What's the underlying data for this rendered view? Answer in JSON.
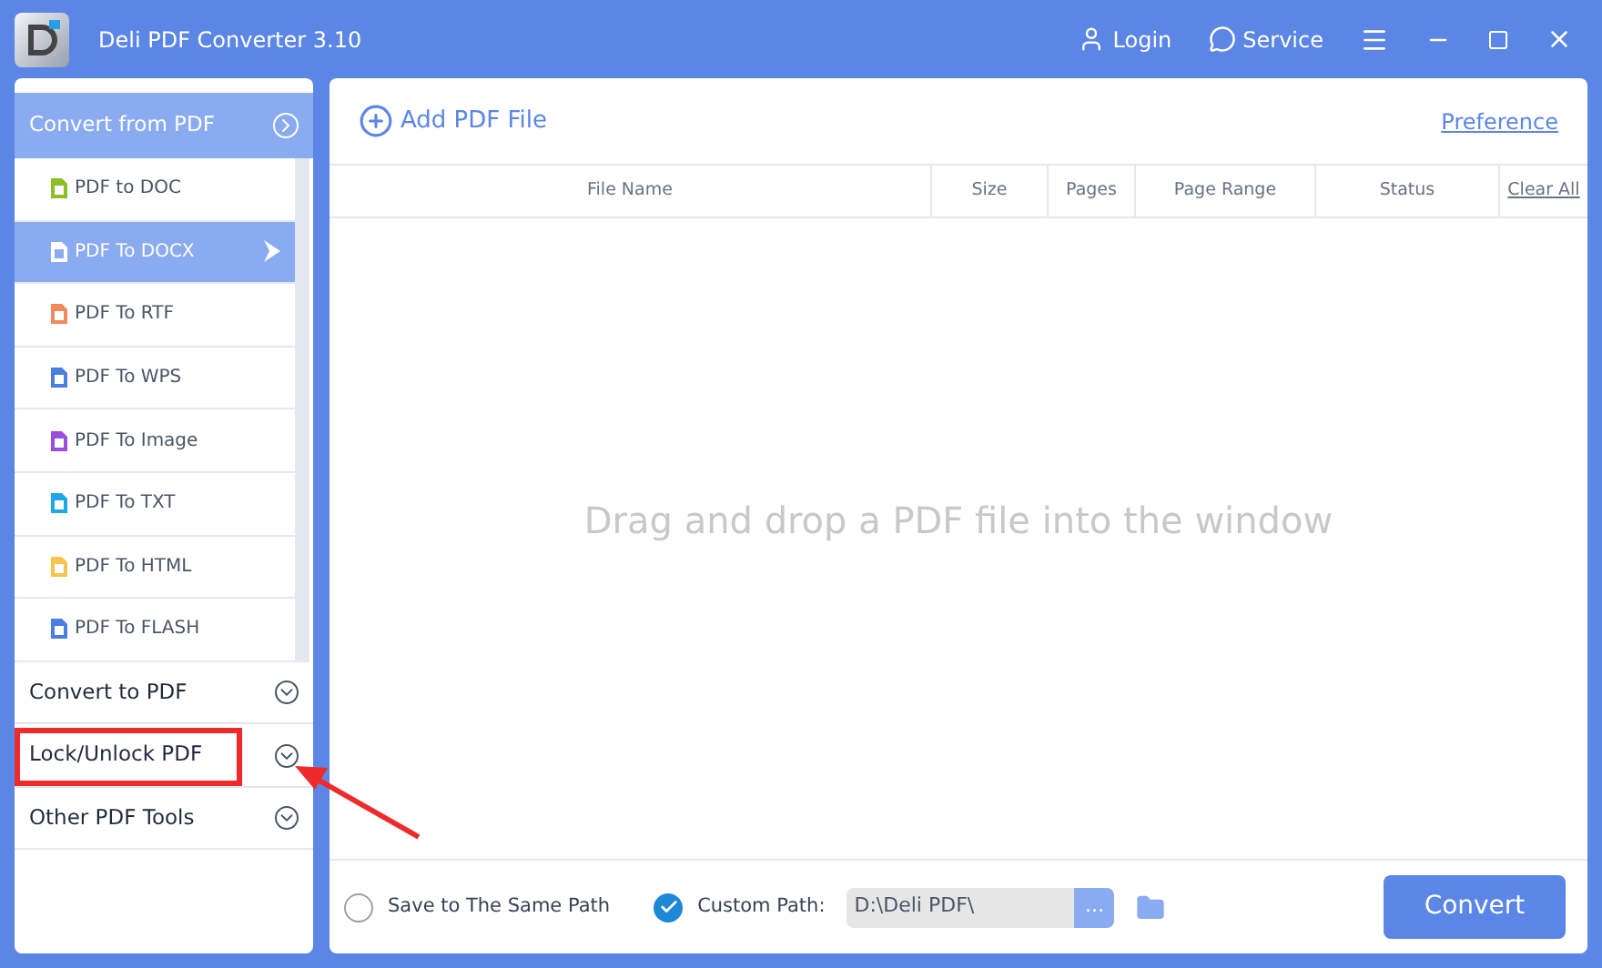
{
  "window": {
    "title": "Deli PDF Converter 3.10",
    "actions": [
      {
        "kind": "login",
        "label": "Login"
      },
      {
        "kind": "service",
        "label": "Service"
      }
    ]
  },
  "sidebar": {
    "sections": [
      {
        "title": "Convert from PDF",
        "expanded": true,
        "highlighted": false,
        "items": [
          {
            "label": "PDF to DOC",
            "color": "#8cbf26",
            "selected": false
          },
          {
            "label": "PDF To DOCX",
            "color": "#ffffff",
            "selected": true
          },
          {
            "label": "PDF To RTF",
            "color": "#f08a5d",
            "selected": false
          },
          {
            "label": "PDF To WPS",
            "color": "#4a7fe0",
            "selected": false
          },
          {
            "label": "PDF To Image",
            "color": "#9b4de0",
            "selected": false
          },
          {
            "label": "PDF To TXT",
            "color": "#1fa8e8",
            "selected": false
          },
          {
            "label": "PDF To HTML",
            "color": "#f5c451",
            "selected": false
          },
          {
            "label": "PDF To FLASH",
            "color": "#4a7fe0",
            "selected": false
          }
        ]
      },
      {
        "title": "Convert to PDF",
        "expanded": false,
        "highlighted": false
      },
      {
        "title": "Lock/Unlock PDF",
        "expanded": false,
        "highlighted": true
      },
      {
        "title": "Other PDF Tools",
        "expanded": false,
        "highlighted": false
      }
    ]
  },
  "toolbar": {
    "add": "Add PDF File",
    "preference": "Preference"
  },
  "table": {
    "columns": [
      "File Name",
      "Size",
      "Pages",
      "Page Range",
      "Status"
    ],
    "clear": "Clear All"
  },
  "empty_message": "Drag and drop a PDF file into the window",
  "footer": {
    "same_path": {
      "label": "Save to The Same Path",
      "selected": false
    },
    "custom_path": {
      "label": "Custom Path:",
      "selected": true
    },
    "path_value": "D:\\Deli PDF\\",
    "browse": "...",
    "convert": "Convert"
  }
}
